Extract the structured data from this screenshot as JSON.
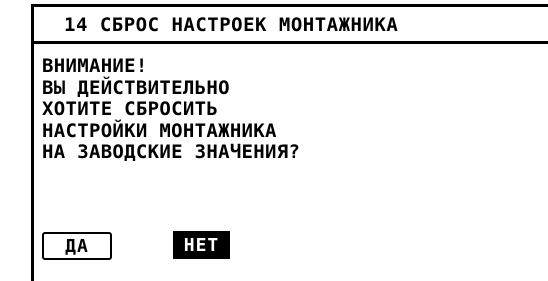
{
  "header": {
    "title": "14 СБРОС НАСТРОЕК МОНТАЖНИКА"
  },
  "dialog": {
    "lines": [
      "ВНИМАНИЕ!",
      "ВЫ ДЕЙСТВИТЕЛЬНО",
      "ХОТИТЕ СБРОСИТЬ",
      "НАСТРОЙКИ МОНТАЖНИКА",
      "НА ЗАВОДСКИЕ ЗНАЧЕНИЯ?"
    ]
  },
  "buttons": {
    "yes_label": "ДА",
    "no_label": "НЕТ",
    "selected": "НЕТ"
  },
  "colors": {
    "foreground": "#000000",
    "background": "#ffffff"
  }
}
